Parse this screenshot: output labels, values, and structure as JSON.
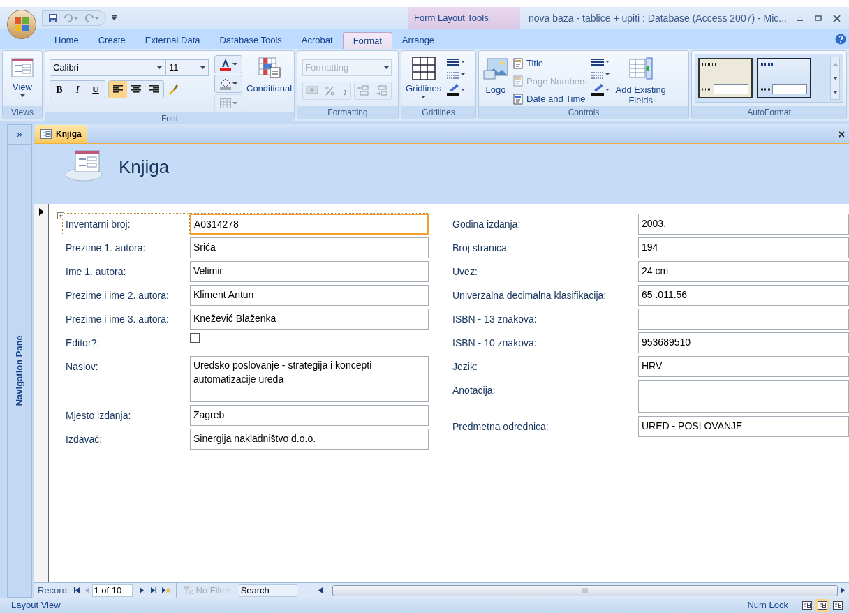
{
  "title_bar": {
    "contextual_label": "Form Layout Tools",
    "title": "nova baza - tablice + upiti : Database (Access 2007) - Mic..."
  },
  "ribbon_tabs": [
    {
      "label": "Home",
      "selected": false
    },
    {
      "label": "Create",
      "selected": false
    },
    {
      "label": "External Data",
      "selected": false
    },
    {
      "label": "Database Tools",
      "selected": false
    },
    {
      "label": "Acrobat",
      "selected": false
    },
    {
      "label": "Format",
      "selected": true
    },
    {
      "label": "Arrange",
      "selected": false
    }
  ],
  "ribbon": {
    "views": {
      "label": "Views",
      "view_button": "View"
    },
    "font": {
      "label": "Font",
      "font_name": "Calibri",
      "font_size": "11",
      "bold": "B",
      "italic": "I",
      "underline": "U",
      "alignment": [
        {
          "selected": true
        },
        {
          "selected": false
        },
        {
          "selected": false
        }
      ],
      "conditional": "Conditional"
    },
    "formatting": {
      "label": "Formatting",
      "format_placeholder": "Formatting"
    },
    "gridlines": {
      "label": "Gridlines",
      "gridlines_button": "Gridlines"
    },
    "controls": {
      "label": "Controls",
      "logo": "Logo",
      "items": [
        {
          "label": "Title",
          "disabled": false
        },
        {
          "label": "Page Numbers",
          "disabled": true
        },
        {
          "label": "Date and Time",
          "disabled": false
        }
      ],
      "add_existing_fields": "Add Existing Fields"
    },
    "autoformat": {
      "label": "AutoFormat",
      "styles": [
        {
          "selected": false
        },
        {
          "selected": true
        }
      ]
    }
  },
  "navigation_pane": {
    "toggle": "»",
    "label": "Navigation Pane"
  },
  "document_tab": {
    "label": "Knjiga",
    "close": "×"
  },
  "form": {
    "title": "Knjiga",
    "left_fields": [
      {
        "label": "Inventarni broj:",
        "value": "A0314278",
        "kind": "text",
        "selected": true
      },
      {
        "label": "Prezime 1. autora:",
        "value": "Srića",
        "kind": "text",
        "selected": false
      },
      {
        "label": "Ime 1. autora:",
        "value": "Velimir",
        "kind": "text",
        "selected": false
      },
      {
        "label": "Prezime i ime 2. autora:",
        "value": "Kliment Antun",
        "kind": "text",
        "selected": false
      },
      {
        "label": "Prezime i ime 3. autora:",
        "value": "Knežević Blaženka",
        "kind": "text",
        "selected": false
      },
      {
        "label": "Editor?:",
        "checked": false,
        "kind": "checkbox",
        "selected": false
      },
      {
        "label": "Naslov:",
        "value": "Uredsko poslovanje - strategija i koncepti automatizacije ureda",
        "kind": "memo",
        "selected": false
      },
      {
        "label": "Mjesto izdanja:",
        "value": "Zagreb",
        "kind": "text",
        "selected": false
      },
      {
        "label": "Izdavač:",
        "value": "Sinergija nakladništvo d.o.o.",
        "kind": "text",
        "selected": false
      }
    ],
    "right_fields": [
      {
        "label": "Godina izdanja:",
        "value": "2003.",
        "kind": "text",
        "selected": false
      },
      {
        "label": "Broj stranica:",
        "value": "194",
        "kind": "text",
        "selected": false
      },
      {
        "label": "Uvez:",
        "value": "24 cm",
        "kind": "text",
        "selected": false
      },
      {
        "label": "Univerzalna decimalna klasifikacija:",
        "value": "65 .011.56",
        "kind": "text",
        "selected": false
      },
      {
        "label": "ISBN - 13 znakova:",
        "kind": "text",
        "selected": false
      },
      {
        "label": "ISBN - 10 znakova:",
        "value": "953689510",
        "kind": "text",
        "selected": false
      },
      {
        "label": "Jezik:",
        "value": "HRV",
        "kind": "text",
        "selected": false
      },
      {
        "label": "Anotacija:",
        "kind": "memo",
        "selected": false
      },
      {
        "label": "Predmetna odrednica:",
        "value": "URED - POSLOVANJE",
        "kind": "text",
        "selected": false
      }
    ]
  },
  "record_navigator": {
    "label": "Record:",
    "position": "1 of 10",
    "filter": "No Filter",
    "search_placeholder": "Search"
  },
  "status_bar": {
    "mode": "Layout View",
    "num_lock": "Num Lock",
    "views": [
      {
        "selected": false
      },
      {
        "selected": true
      },
      {
        "selected": false
      }
    ]
  }
}
